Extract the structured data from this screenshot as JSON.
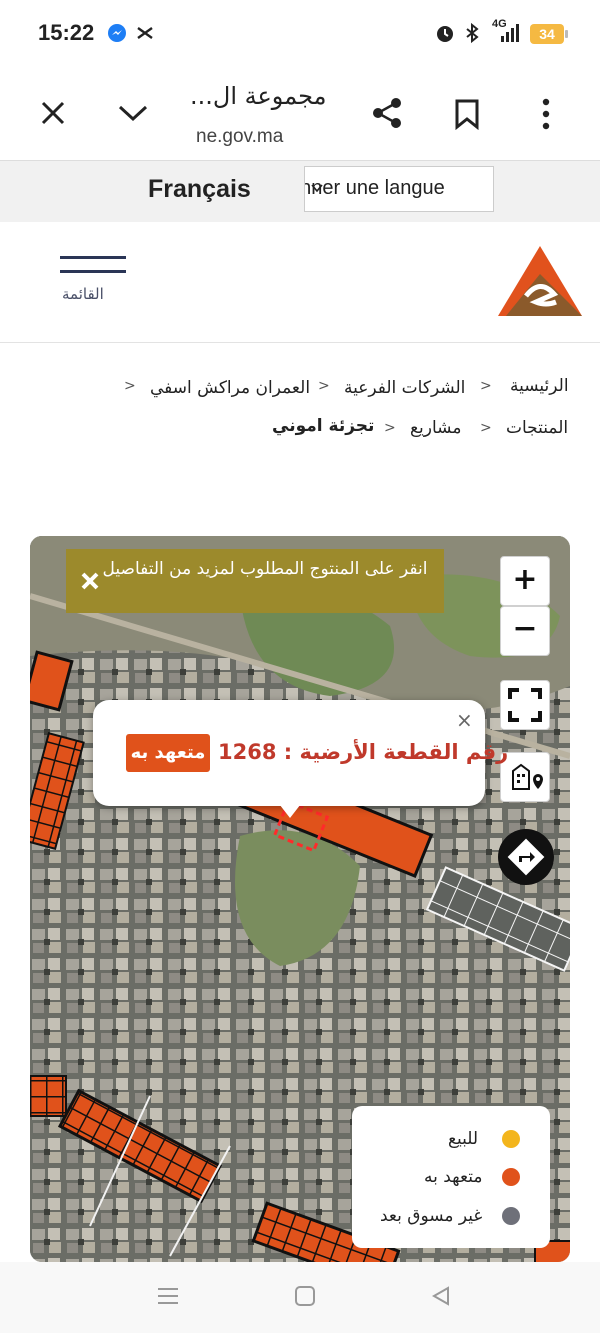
{
  "status_bar": {
    "time": "15:22",
    "network": "4G",
    "battery": "34",
    "icons": [
      "messenger-icon",
      "capcut-icon",
      "alarm-icon",
      "bluetooth-icon",
      "signal-icon",
      "battery-icon"
    ]
  },
  "browser": {
    "title": "مجموعة ال...",
    "url": "ne.gov.ma",
    "icons": [
      "close-icon",
      "chevron-down-icon",
      "share-icon",
      "bookmark-icon",
      "more-icon"
    ]
  },
  "translate": {
    "language": "Français",
    "select_label": "Sélectionner une langue"
  },
  "header": {
    "menu_label": "القائمة",
    "logo_colors": [
      "#d94a1a",
      "#8a5a2b"
    ]
  },
  "breadcrumb": {
    "row1": [
      "الرئيسية",
      "الشركات الفرعية",
      "العمران مراكش اسفي"
    ],
    "row2": [
      "المنتجات",
      "مشاريع",
      "تجزئة اموني"
    ],
    "separator": ">"
  },
  "map": {
    "notice": "انقر على المنتوج المطلوب لمزيد من التفاصيل",
    "controls": {
      "zoom_in": "+",
      "zoom_out": "−"
    },
    "popup": {
      "title": "رقم القطعة الأرضية : 1268",
      "status": "متعهد به",
      "close": "×"
    },
    "legend": [
      {
        "label": "للبيع",
        "color": "#f3b51c"
      },
      {
        "label": "متعهد به",
        "color": "#e0521b"
      },
      {
        "label": "غير مسوق بعد",
        "color": "#6e7079"
      }
    ]
  },
  "nav_icons": [
    "menu-icon",
    "home-icon",
    "back-icon"
  ]
}
